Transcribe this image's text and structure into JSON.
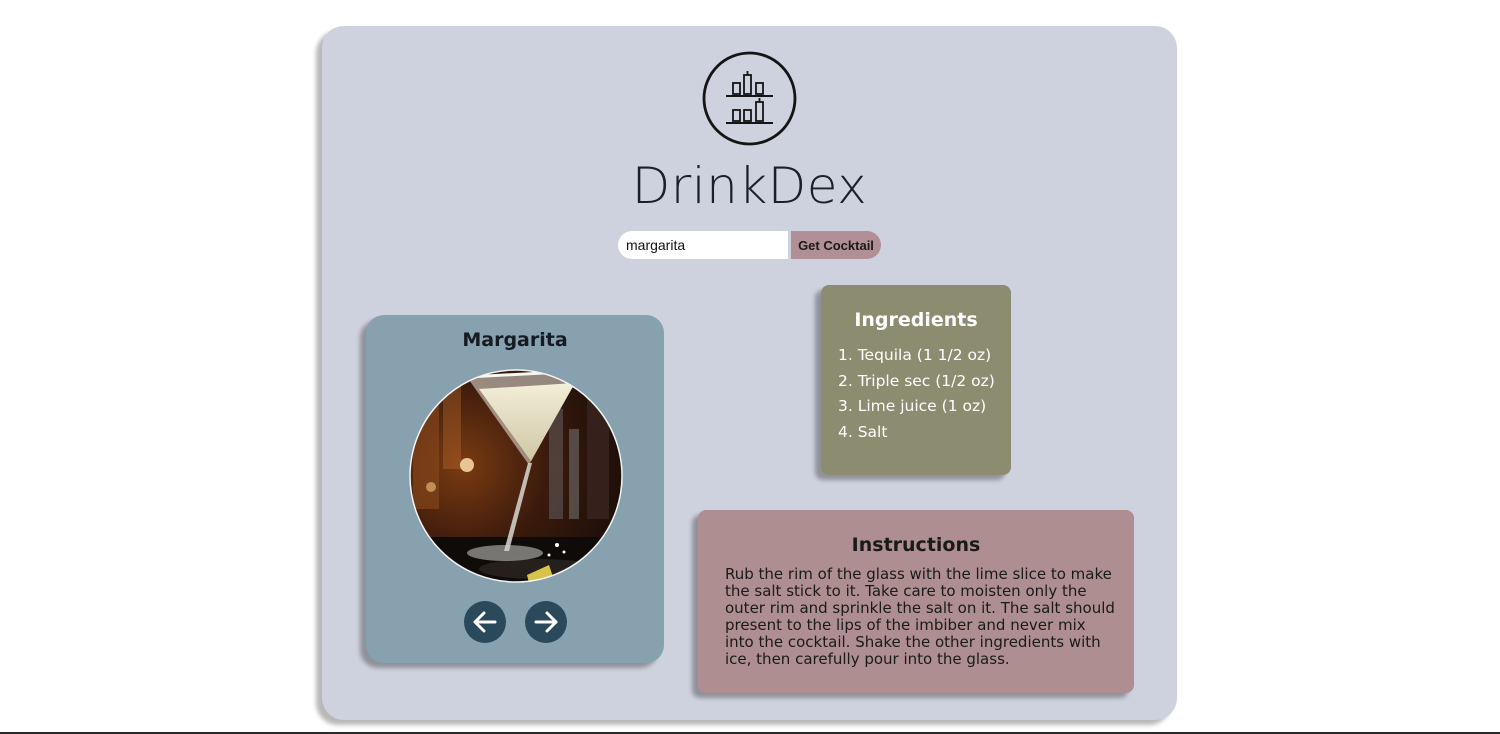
{
  "app": {
    "title": "DrinkDex",
    "logo_icon": "bar-shelf-bottles-icon"
  },
  "search": {
    "value": "margarita",
    "button_label": "Get Cocktail"
  },
  "drink": {
    "name": "Margarita",
    "photo": "margarita-glass-photo",
    "prev_icon": "arrow-left-icon",
    "next_icon": "arrow-right-icon"
  },
  "ingredients": {
    "title": "Ingredients",
    "items": [
      "1. Tequila (1 1/2 oz)",
      "2. Triple sec (1/2 oz)",
      "3. Lime juice (1 oz)",
      "4. Salt"
    ]
  },
  "instructions": {
    "title": "Instructions",
    "text": "Rub the rim of the glass with the lime slice to make the salt stick to it. Take care to moisten only the outer rim and sprinkle the salt on it. The salt should present to the lips of the imbiber and never mix into the cocktail. Shake the other ingredients with ice, then carefully pour into the glass."
  },
  "colors": {
    "page_background": "#ffffff",
    "main_card": "#ced1de",
    "drink_card": "#87a1ae",
    "ingredients_card": "#8c8c71",
    "instructions_card": "#af8e92",
    "button": "#b09096",
    "nav_button": "#2a4a5c"
  }
}
